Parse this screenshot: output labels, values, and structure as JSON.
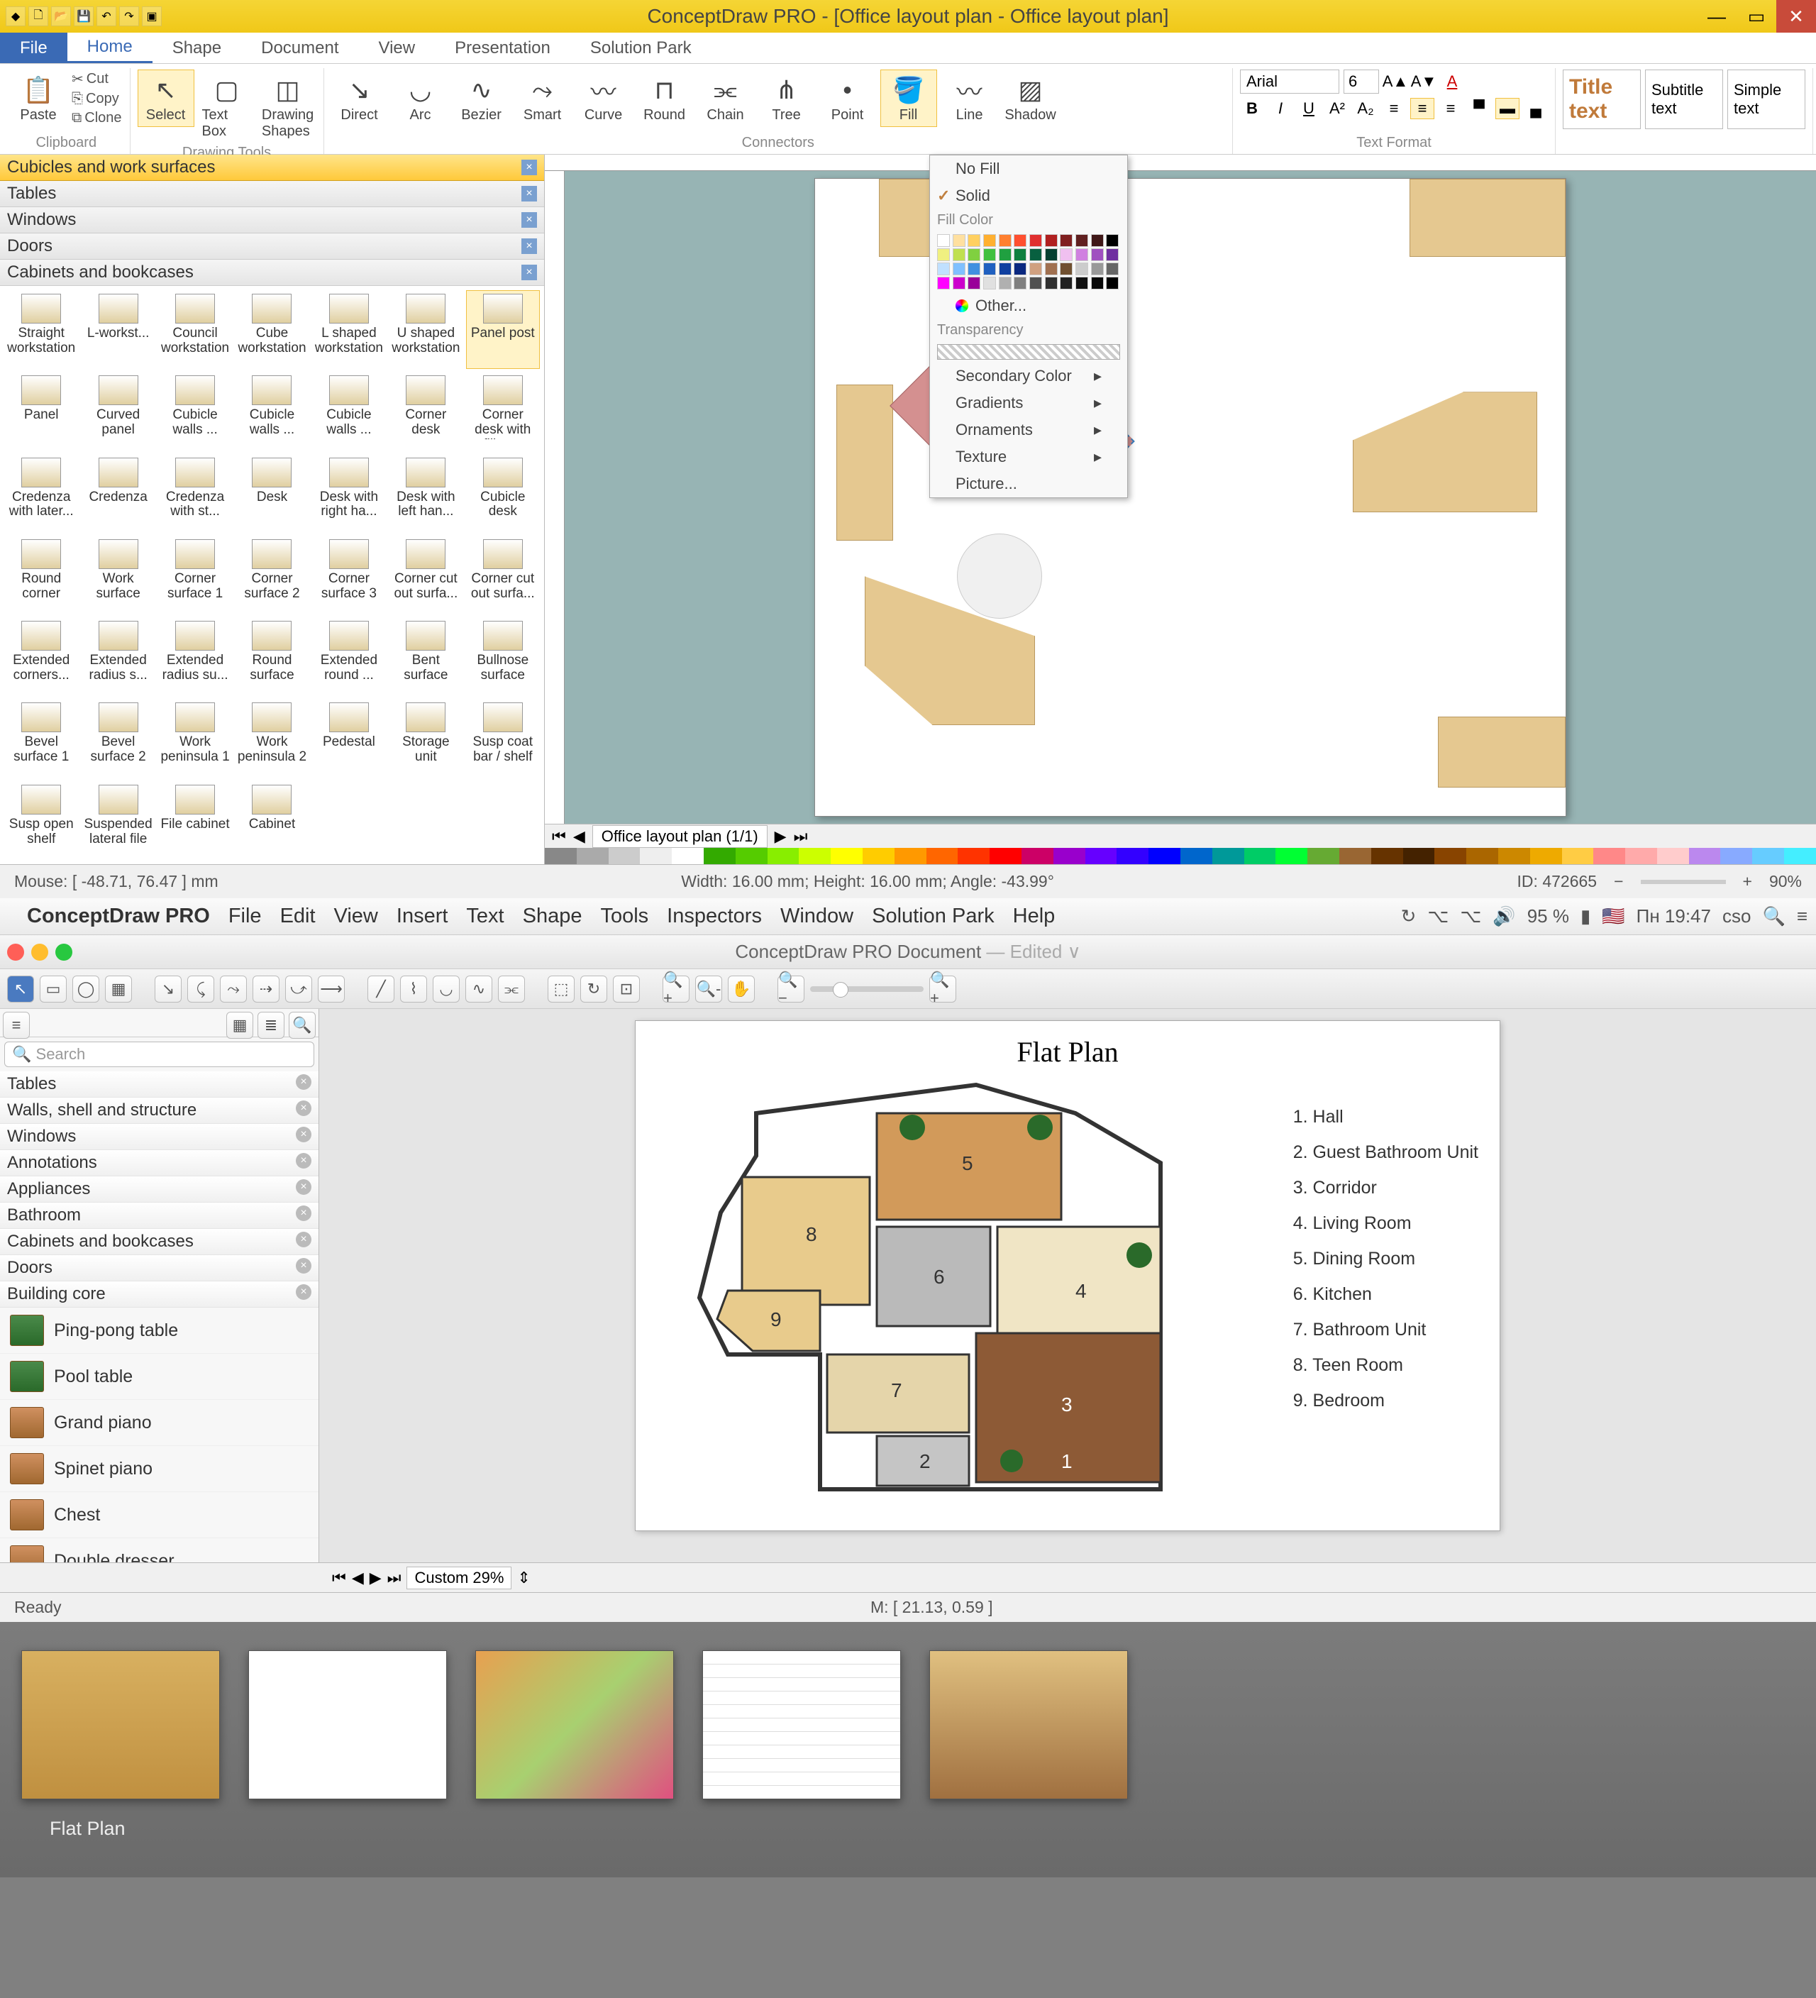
{
  "win": {
    "title": "ConceptDraw PRO - [Office layout plan - Office layout plan]",
    "tabs": [
      "File",
      "Home",
      "Shape",
      "Document",
      "View",
      "Presentation",
      "Solution Park"
    ],
    "active_tab": "Home",
    "clipboard": {
      "paste": "Paste",
      "cut": "Cut",
      "copy": "Copy",
      "clone": "Clone",
      "label": "Clipboard"
    },
    "drawtools": {
      "select": "Select",
      "textbox": "Text Box",
      "shapes": "Drawing Shapes",
      "label": "Drawing Tools"
    },
    "connectors": {
      "items": [
        "Direct",
        "Arc",
        "Bezier",
        "Smart",
        "Curve",
        "Round",
        "Chain",
        "Tree",
        "Point",
        "Fill",
        "Line",
        "Shadow"
      ],
      "label": "Connectors"
    },
    "textformat": {
      "font": "Arial",
      "size": "6",
      "label": "Text Format"
    },
    "styles": {
      "title": "Title text",
      "subtitle": "Subtitle text",
      "simple": "Simple text"
    },
    "panel": {
      "sections": [
        "Cubicles and work surfaces",
        "Tables",
        "Windows",
        "Doors",
        "Cabinets and bookcases"
      ],
      "active_section": "Cubicles and work surfaces",
      "shapes": [
        "Straight workstation",
        "L-workst...",
        "Council workstation",
        "Cube workstation",
        "L shaped workstation",
        "U shaped workstation",
        "Panel post",
        "Panel",
        "Curved panel",
        "Cubicle walls ...",
        "Cubicle walls ...",
        "Cubicle walls ...",
        "Corner desk",
        "Corner desk with filing...",
        "Credenza with later...",
        "Credenza",
        "Credenza with st...",
        "Desk",
        "Desk with right ha...",
        "Desk with left han...",
        "Cubicle desk",
        "Round corner",
        "Work surface",
        "Corner surface 1",
        "Corner surface 2",
        "Corner surface 3",
        "Corner cut out surfa...",
        "Corner cut out surfa...",
        "Extended corners...",
        "Extended radius s...",
        "Extended radius su...",
        "Round surface",
        "Extended round ...",
        "Bent surface",
        "Bullnose surface",
        "Bevel surface 1",
        "Bevel surface 2",
        "Work peninsula 1",
        "Work peninsula 2",
        "Pedestal",
        "Storage unit",
        "Susp coat bar / shelf",
        "Susp open shelf",
        "Suspended lateral file",
        "File cabinet",
        "Cabinet"
      ],
      "selected_shape": "Panel post"
    },
    "fill_dropdown": {
      "no_fill": "No Fill",
      "solid": "Solid",
      "fill_color": "Fill Color",
      "other": "Other...",
      "transparency": "Transparency",
      "secondary": "Secondary Color",
      "gradients": "Gradients",
      "ornaments": "Ornaments",
      "texture": "Texture",
      "picture": "Picture..."
    },
    "page_tab": "Office layout plan (1/1)",
    "status": {
      "mouse": "Mouse: [ -48.71, 76.47 ] mm",
      "dims": "Width: 16.00 mm;  Height: 16.00 mm;  Angle: -43.99°",
      "id": "ID: 472665",
      "zoom": "90%"
    }
  },
  "mac": {
    "menubar": [
      "File",
      "Edit",
      "View",
      "Insert",
      "Text",
      "Shape",
      "Tools",
      "Inspectors",
      "Window",
      "Solution Park",
      "Help"
    ],
    "appname": "ConceptDraw PRO",
    "status_right": {
      "battery": "95 %",
      "clock": "Пн 19:47",
      "user": "cso"
    },
    "doc_title": "ConceptDraw PRO Document",
    "doc_edit": "— Edited ∨",
    "search_placeholder": "Search",
    "categories": [
      "Tables",
      "Walls, shell and structure",
      "Windows",
      "Annotations",
      "Appliances",
      "Bathroom",
      "Cabinets and bookcases",
      "Doors",
      "Building core"
    ],
    "lib_items": [
      "Ping-pong table",
      "Pool table",
      "Grand piano",
      "Spinet piano",
      "Chest",
      "Double dresser"
    ],
    "canvas_title": "Flat Plan",
    "legend": [
      "1. Hall",
      "2. Guest Bathroom Unit",
      "3. Corridor",
      "4. Living Room",
      "5. Dining Room",
      "6. Kitchen",
      "7. Bathroom Unit",
      "8. Teen Room",
      "9. Bedroom"
    ],
    "room_numbers": [
      "1",
      "2",
      "3",
      "4",
      "5",
      "6",
      "7",
      "8",
      "9"
    ],
    "zoom_label": "Custom 29%",
    "status_ready": "Ready",
    "status_mouse": "M: [ 21.13, 0.59 ]"
  },
  "gallery": {
    "label": "Flat Plan"
  }
}
